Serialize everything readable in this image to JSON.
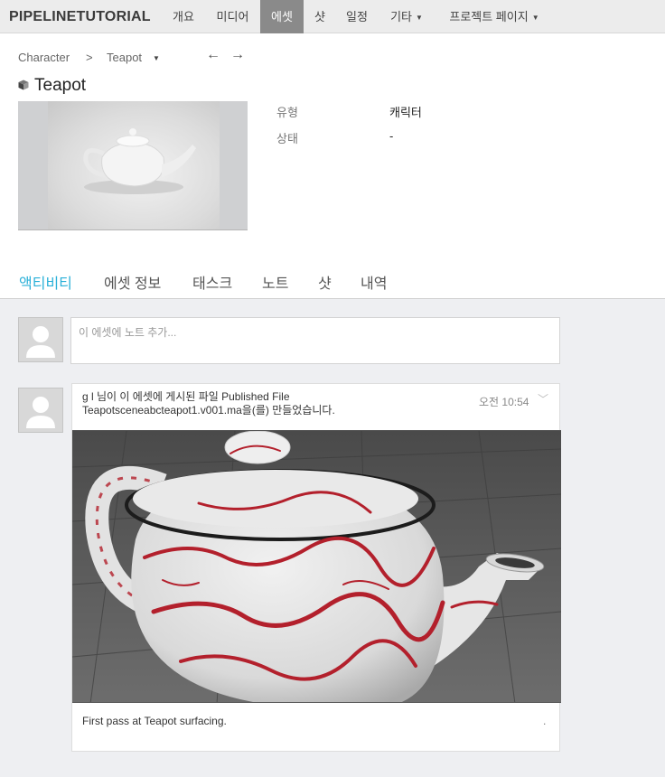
{
  "nav": {
    "brand": "PIPELINETUTORIAL",
    "items": [
      {
        "label": "개요"
      },
      {
        "label": "미디어"
      },
      {
        "label": "에셋"
      },
      {
        "label": "샷"
      },
      {
        "label": "일정"
      },
      {
        "label": "기타"
      },
      {
        "label": "프로젝트 페이지"
      }
    ],
    "active": "에셋"
  },
  "breadcrumb": {
    "root": "Character",
    "separator": ">",
    "current": "Teapot",
    "prev_arrow": "←",
    "next_arrow": "→"
  },
  "asset": {
    "title": "Teapot",
    "fields": [
      {
        "label": "유형",
        "value": "캐릭터"
      },
      {
        "label": "상태",
        "value": "-"
      }
    ]
  },
  "tabs": [
    {
      "label": "액티비티",
      "active": true
    },
    {
      "label": "에셋 정보"
    },
    {
      "label": "태스크"
    },
    {
      "label": "노트"
    },
    {
      "label": "샷"
    },
    {
      "label": "내역"
    }
  ],
  "activity": {
    "note_placeholder": "이 에셋에 노트 추가...",
    "post": {
      "line1": "g l 님이 이 에셋에 게시된 파일 Published File",
      "line2": "Teapotsceneabcteapot1.v001.ma을(를) 만들었습니다.",
      "time": "오전 10:54",
      "caption": "First pass at Teapot surfacing.",
      "dot": "."
    }
  },
  "colors": {
    "accent": "#2ab0d8",
    "nav_active_bg": "#8a8a8a",
    "activity_bg": "#eeeff2",
    "marble_red": "#b3202c"
  }
}
